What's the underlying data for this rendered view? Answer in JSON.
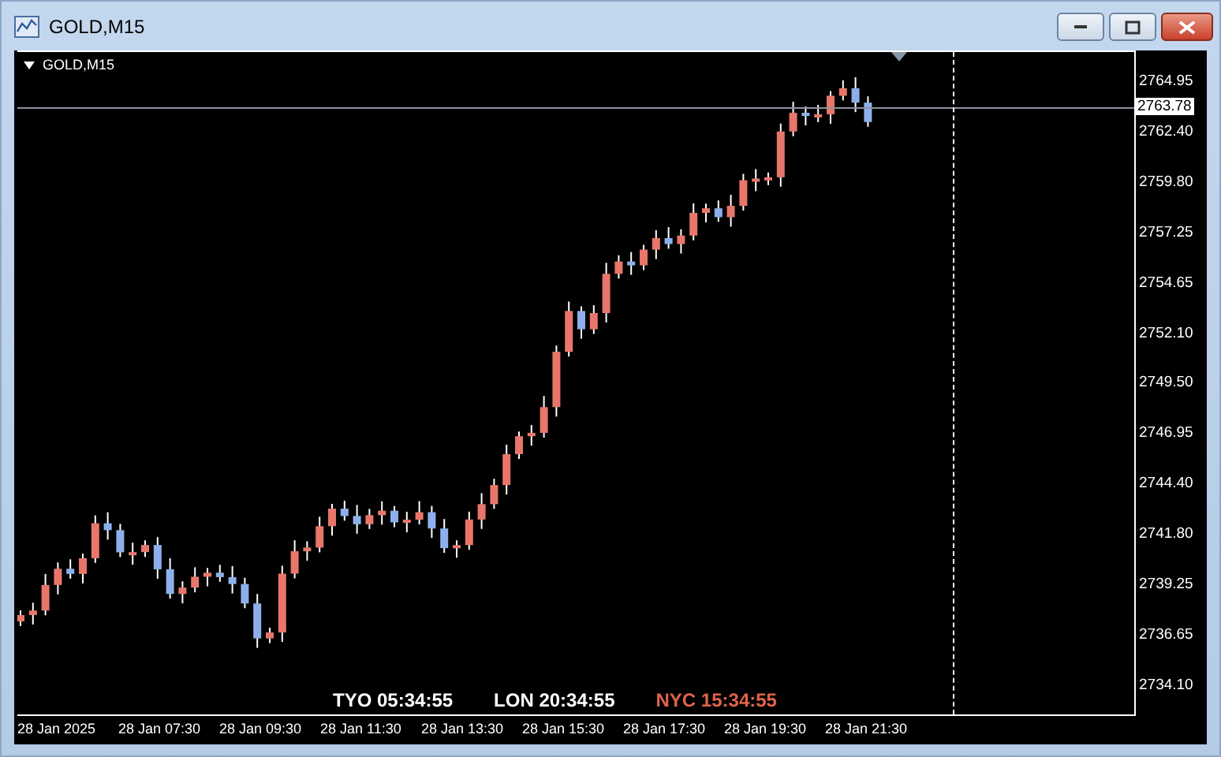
{
  "window": {
    "title": "GOLD,M15"
  },
  "chart": {
    "label": "GOLD,M15",
    "price_ticks": [
      "2764.95",
      "2762.40",
      "2759.80",
      "2757.25",
      "2754.65",
      "2752.10",
      "2749.50",
      "2746.95",
      "2744.40",
      "2741.80",
      "2739.25",
      "2736.65",
      "2734.10"
    ],
    "current_price": "2763.78",
    "time_ticks": [
      "28 Jan 2025",
      "28 Jan 07:30",
      "28 Jan 09:30",
      "28 Jan 11:30",
      "28 Jan 13:30",
      "28 Jan 15:30",
      "28 Jan 17:30",
      "28 Jan 19:30",
      "28 Jan 21:30"
    ],
    "clocks": [
      {
        "label": "TYO 05:34:55",
        "color": "#ffffff"
      },
      {
        "label": "LON 20:34:55",
        "color": "#ffffff"
      },
      {
        "label": "NYC 15:34:55",
        "color": "#e0634a"
      }
    ]
  }
}
